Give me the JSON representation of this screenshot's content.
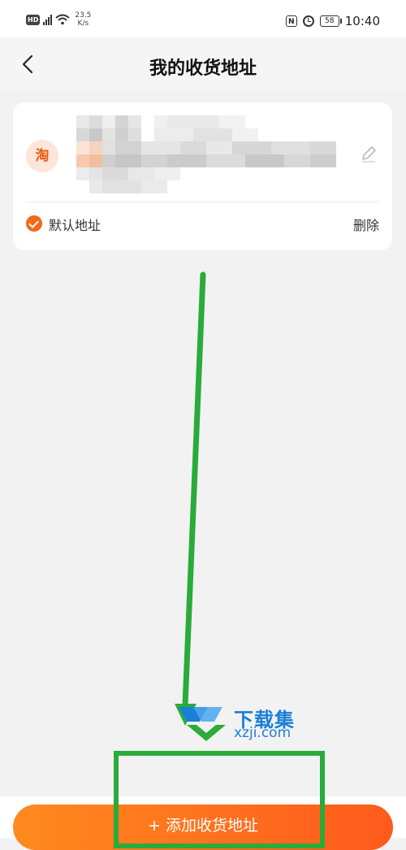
{
  "status_bar": {
    "hd": "HD",
    "network_speed": "23.5",
    "network_unit": "K/s",
    "nfc": "N",
    "battery": "58",
    "time": "10:40"
  },
  "header": {
    "title": "我的收货地址",
    "back_icon": "chevron-left-icon"
  },
  "address_card": {
    "avatar_text": "淘",
    "edit_icon": "pencil-icon",
    "default_label": "默认地址",
    "default_checked": true,
    "delete_label": "删除"
  },
  "watermark": {
    "title": "下载集",
    "url": "xzji.com"
  },
  "footer": {
    "add_button_label": "+ 添加收货地址"
  },
  "colors": {
    "accent": "#ff6a1e",
    "annotation_green": "#2aab3a",
    "watermark_blue": "#1a7fd6"
  }
}
